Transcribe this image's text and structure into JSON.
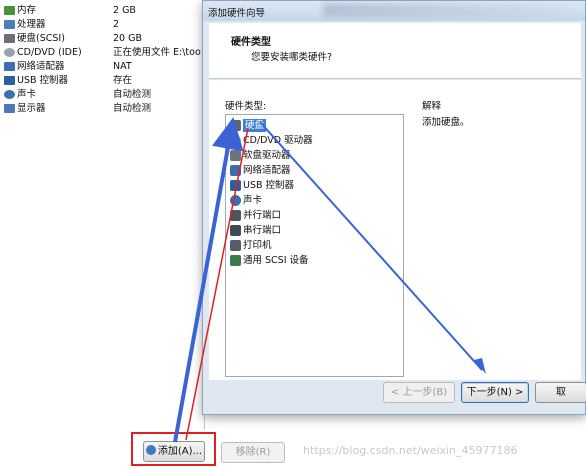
{
  "hardware_list": [
    {
      "name": "内存",
      "value": "2 GB",
      "icon": "memory-icon",
      "color": "#4a8f3c"
    },
    {
      "name": "处理器",
      "value": "2",
      "icon": "cpu-icon",
      "color": "#4a7fb8"
    },
    {
      "name": "硬盘(SCSI)",
      "value": "20 GB",
      "icon": "hard-disk-icon",
      "color": "#6b6f78"
    },
    {
      "name": "CD/DVD (IDE)",
      "value": "正在使用文件 E:\\too",
      "icon": "cd-dvd-icon",
      "color": "#9aa3ad"
    },
    {
      "name": "网络适配器",
      "value": "NAT",
      "icon": "network-adapter-icon",
      "color": "#3d6fb0"
    },
    {
      "name": "USB 控制器",
      "value": "存在",
      "icon": "usb-icon",
      "color": "#2f5f9f"
    },
    {
      "name": "声卡",
      "value": "自动检测",
      "icon": "sound-icon",
      "color": "#3b6db3"
    },
    {
      "name": "显示器",
      "value": "自动检测",
      "icon": "display-icon",
      "color": "#4b79b8"
    }
  ],
  "buttons": {
    "add": "添加(A)...",
    "remove": "移除(R)"
  },
  "watermark": "https://blog.csdn.net/weixin_45977186",
  "wizard": {
    "title": "添加硬件向导",
    "header_title": "硬件类型",
    "header_subtitle": "您要安装哪类硬件?",
    "hw_type_label": "硬件类型:",
    "explain_label": "解释",
    "explain_text": "添加硬盘。",
    "items": [
      {
        "label": "硬盘",
        "icon": "hard-disk-icon",
        "color": "#5e6470",
        "selected": true
      },
      {
        "label": "CD/DVD 驱动器",
        "icon": "cd-dvd-icon",
        "color": "#a0a8b2",
        "selected": false
      },
      {
        "label": "软盘驱动器",
        "icon": "floppy-icon",
        "color": "#6c7480",
        "selected": false
      },
      {
        "label": "网络适配器",
        "icon": "network-adapter-icon",
        "color": "#3d6fb0",
        "selected": false
      },
      {
        "label": "USB 控制器",
        "icon": "usb-icon",
        "color": "#2f5f9f",
        "selected": false
      },
      {
        "label": "声卡",
        "icon": "sound-icon",
        "color": "#3b6db3",
        "selected": false
      },
      {
        "label": "并行端口",
        "icon": "parallel-port-icon",
        "color": "#4b5560",
        "selected": false
      },
      {
        "label": "串行端口",
        "icon": "serial-port-icon",
        "color": "#3f4a56",
        "selected": false
      },
      {
        "label": "打印机",
        "icon": "printer-icon",
        "color": "#555d66",
        "selected": false
      },
      {
        "label": "通用 SCSI 设备",
        "icon": "scsi-device-icon",
        "color": "#3b7a4a",
        "selected": false
      }
    ],
    "back_button": "< 上一步(B)",
    "next_button": "下一步(N) >",
    "cancel_button": "取"
  },
  "annotation_colors": {
    "arrow": "#3b63d6",
    "highlight": "#e02020"
  }
}
